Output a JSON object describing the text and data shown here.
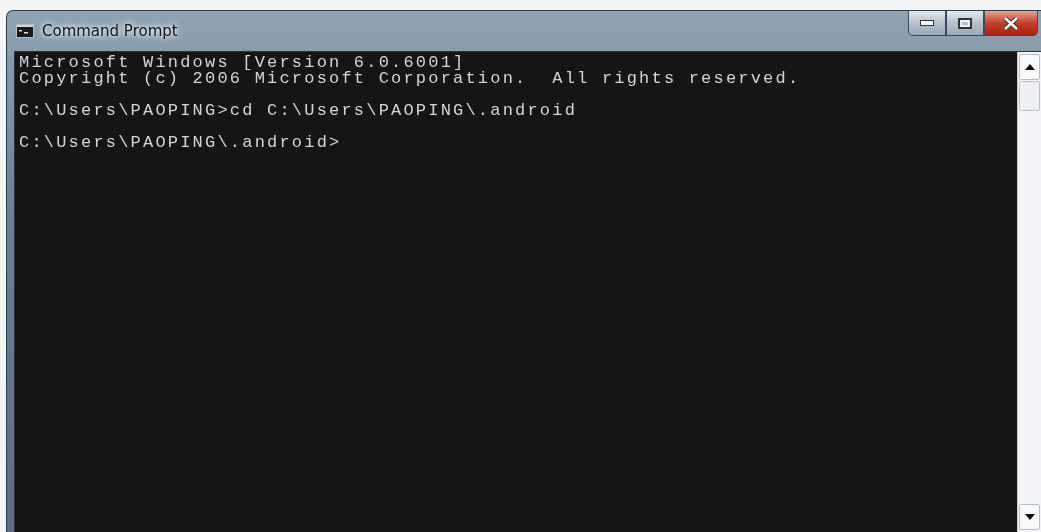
{
  "window": {
    "title": "Command Prompt"
  },
  "console": {
    "blocks": [
      [
        "Microsoft Windows [Version 6.0.6001]",
        "Copyright (c) 2006 Microsoft Corporation.  All rights reserved."
      ],
      [
        "C:\\Users\\PAOPING>cd C:\\Users\\PAOPING\\.android"
      ],
      [
        "C:\\Users\\PAOPING\\.android>"
      ]
    ]
  }
}
